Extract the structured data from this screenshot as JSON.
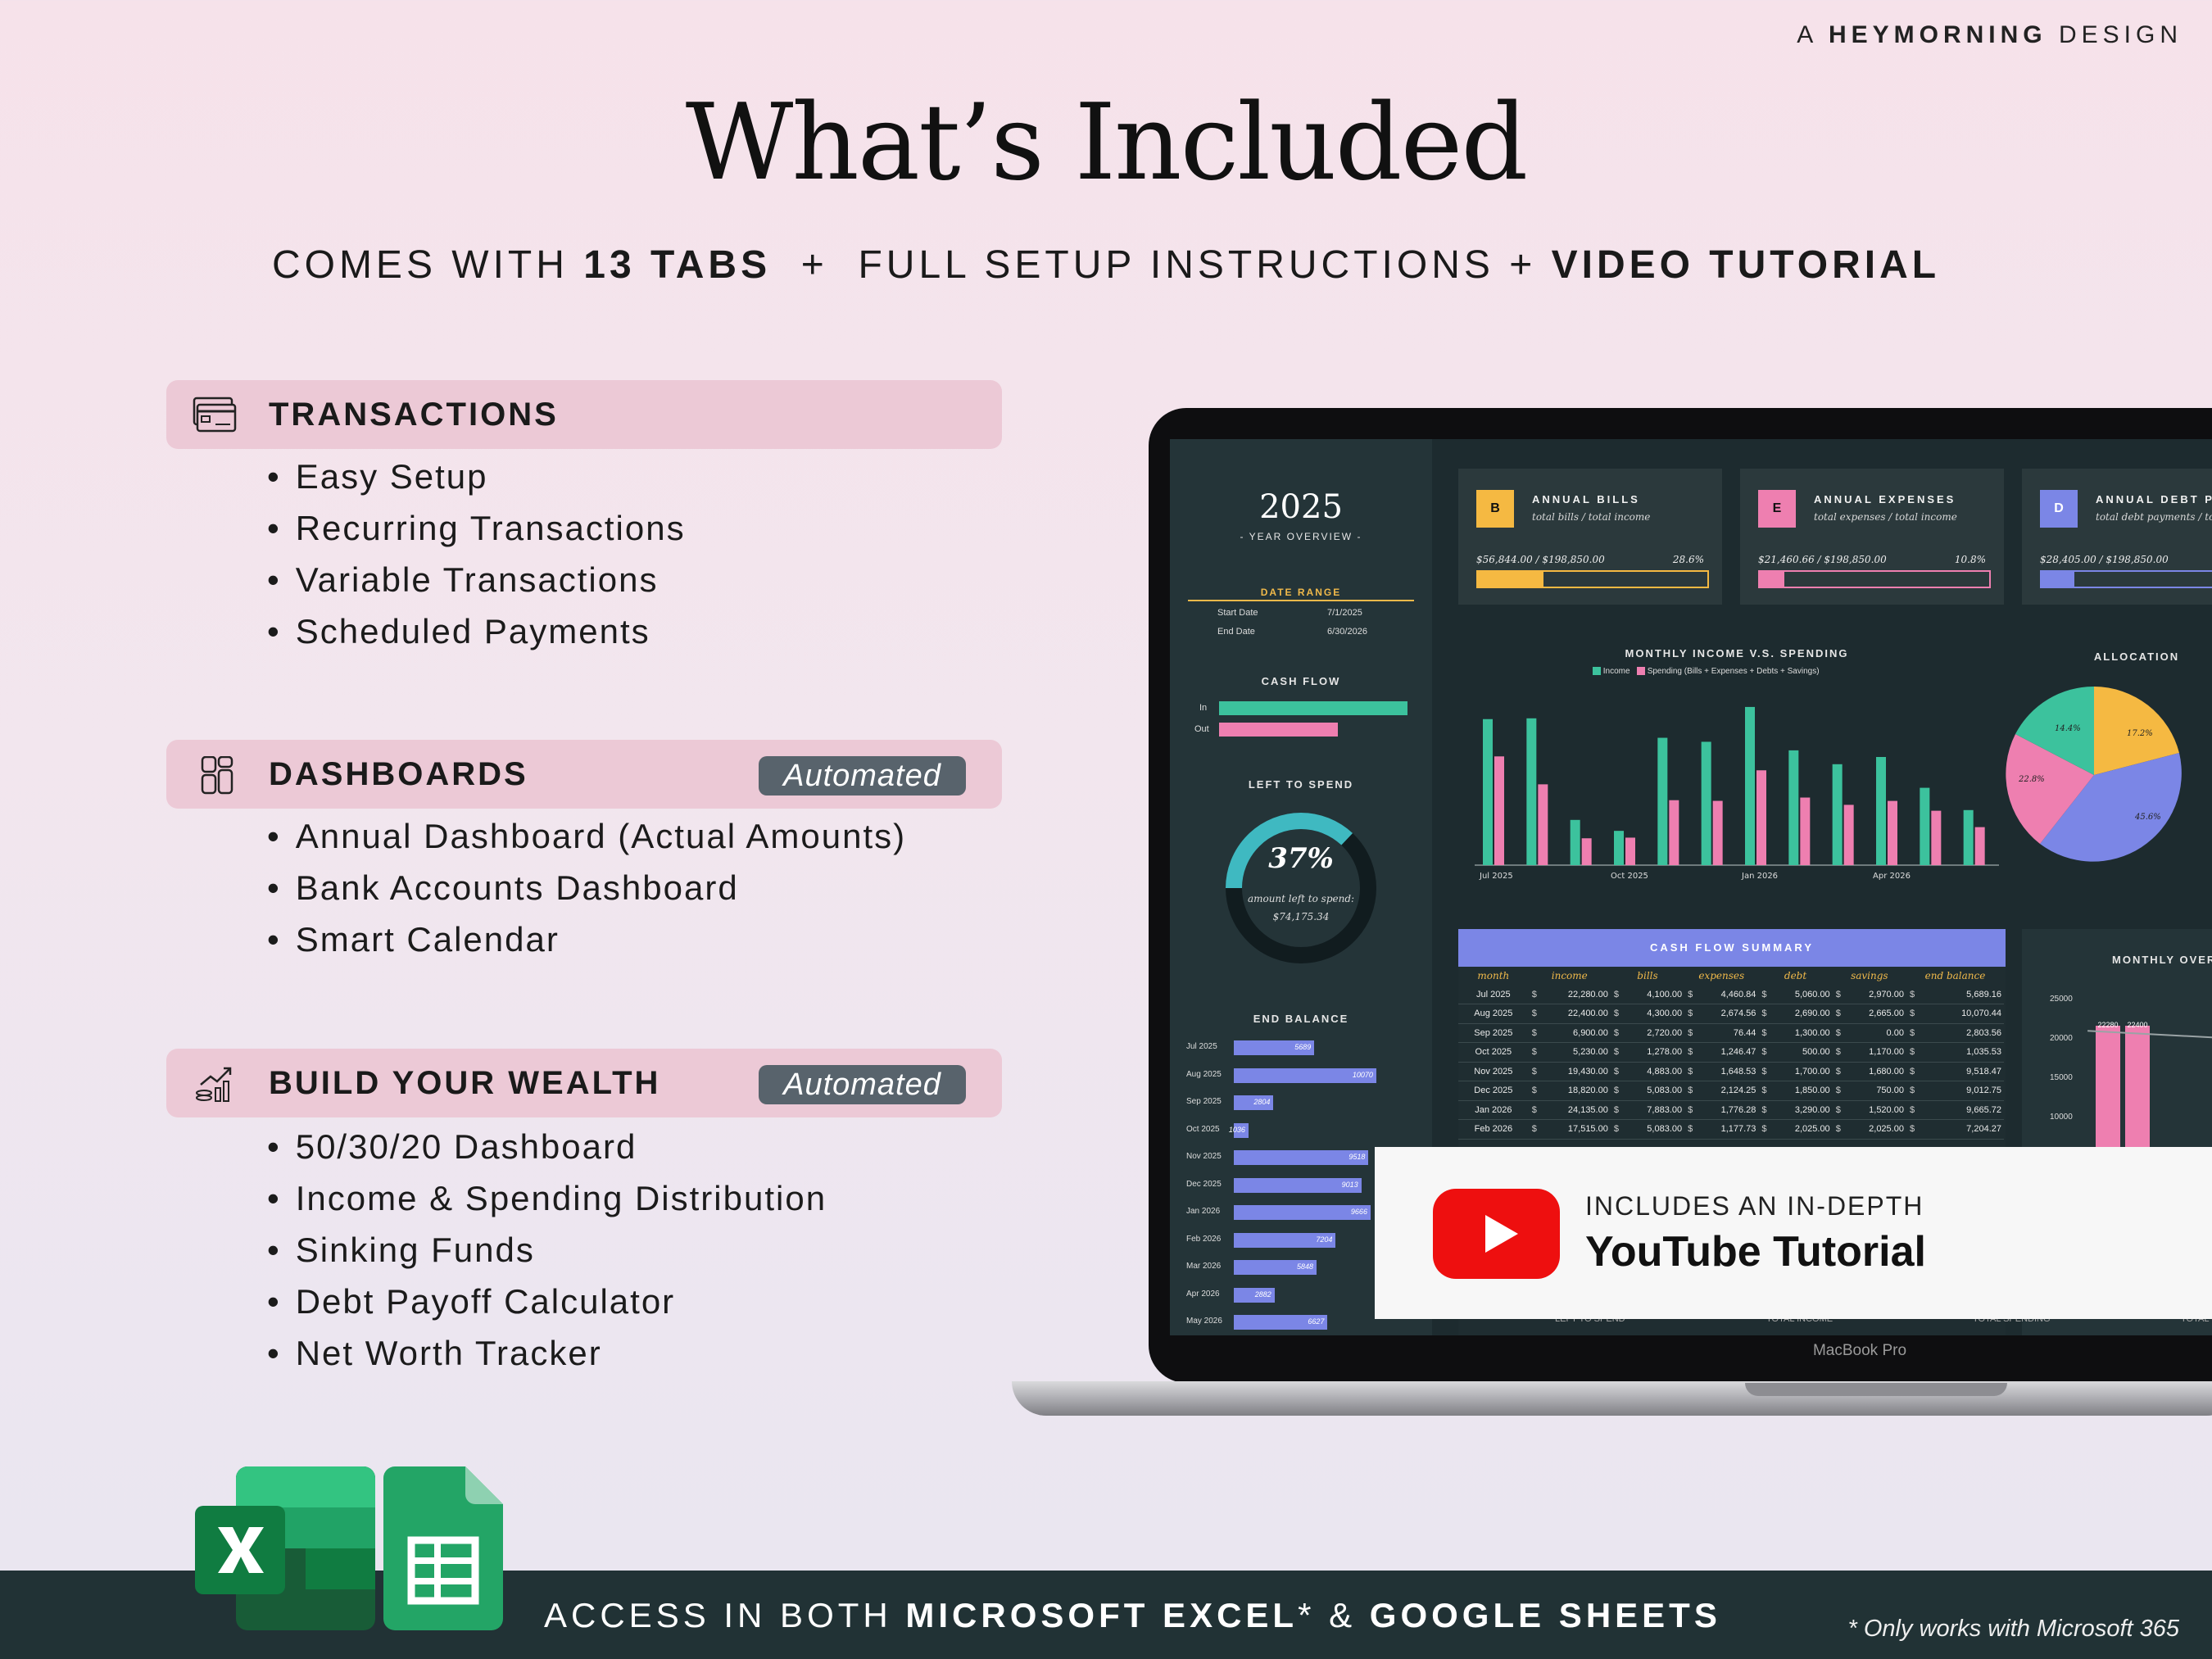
{
  "brand": {
    "prefix": "A ",
    "name": "HEYMORNING",
    "suffix": " DESIGN"
  },
  "title": "What’s Included",
  "subtitle": {
    "p1": "COMES WITH ",
    "b1": "13 TABS",
    "p2": "  +  FULL SETUP INSTRUCTIONS + ",
    "b2": "VIDEO TUTORIAL"
  },
  "sections": [
    {
      "label": "TRANSACTIONS",
      "icon": "credit-card-icon",
      "items": [
        "Easy Setup",
        "Recurring Transactions",
        "Variable Transactions",
        "Scheduled Payments"
      ]
    },
    {
      "label": "DASHBOARDS",
      "icon": "dashboard-grid-icon",
      "badge": "Automated",
      "items": [
        "Annual Dashboard (Actual Amounts)",
        "Bank Accounts Dashboard",
        "Smart Calendar"
      ]
    },
    {
      "label": "BUILD YOUR WEALTH",
      "icon": "growth-chart-icon",
      "badge": "Automated",
      "items": [
        "50/30/20 Dashboard",
        "Income & Spending Distribution",
        "Sinking Funds",
        "Debt Payoff Calculator",
        "Net Worth Tracker"
      ]
    }
  ],
  "laptop": {
    "model": "MacBook Pro"
  },
  "dashboard": {
    "year": "2025",
    "year_label": "- YEAR OVERVIEW -",
    "date_range": {
      "label": "DATE RANGE",
      "start_label": "Start Date",
      "start": "7/1/2025",
      "end_label": "End Date",
      "end": "6/30/2026"
    },
    "cash_flow": {
      "label": "CASH FLOW",
      "in_label": "In",
      "out_label": "Out",
      "in_value": 1.0,
      "out_value": 0.63
    },
    "left_to_spend": {
      "label": "LEFT TO SPEND",
      "percent": "37%",
      "caption": "amount left to spend:",
      "amount": "$74,175.34",
      "fraction": 0.37
    },
    "end_balance": {
      "label": "END BALANCE",
      "rows": [
        {
          "m": "Jul 2025",
          "v": 5689
        },
        {
          "m": "Aug 2025",
          "v": 10070
        },
        {
          "m": "Sep 2025",
          "v": 2804
        },
        {
          "m": "Oct 2025",
          "v": 1036
        },
        {
          "m": "Nov 2025",
          "v": 9518
        },
        {
          "m": "Dec 2025",
          "v": 9013
        },
        {
          "m": "Jan 2026",
          "v": 9666
        },
        {
          "m": "Feb 2026",
          "v": 7204
        },
        {
          "m": "Mar 2026",
          "v": 5848
        },
        {
          "m": "Apr 2026",
          "v": 2882
        },
        {
          "m": "May 2026",
          "v": 6627
        }
      ]
    },
    "kpis": [
      {
        "letter": "B",
        "title": "ANNUAL BILLS",
        "sub": "total bills / total income",
        "amount": "$56,844.00 / $198,850.00",
        "pct": "28.6%",
        "color": "#f5b942",
        "fill": 0.286
      },
      {
        "letter": "E",
        "title": "ANNUAL EXPENSES",
        "sub": "total expenses / total income",
        "amount": "$21,460.66 / $198,850.00",
        "pct": "10.8%",
        "color": "#ee7fb0",
        "fill": 0.108
      },
      {
        "letter": "D",
        "title": "ANNUAL DEBT PA",
        "sub": "total debt payments / tota",
        "amount": "$28,405.00 / $198,850.00",
        "pct": "",
        "color": "#7b86e6",
        "fill": 0.143
      }
    ],
    "monthly_chart": {
      "title": "MONTHLY INCOME V.S. SPENDING",
      "legend": [
        "Income",
        "Spending (Bills + Expenses + Debts + Savings)"
      ],
      "ticks": [
        "Jul 2025",
        "Oct 2025",
        "Jan 2026",
        "Apr 2026"
      ]
    },
    "allocation": {
      "title": "ALLOCATION",
      "labels": [
        "14.4%",
        "17.2%",
        "22.8%",
        "45.6%"
      ]
    },
    "cash_flow_summary": {
      "title": "CASH FLOW SUMMARY",
      "headers": [
        "month",
        "income",
        "bills",
        "expenses",
        "debt",
        "savings",
        "end balance"
      ],
      "rows": [
        [
          "Jul 2025",
          "22,280.00",
          "4,100.00",
          "4,460.84",
          "5,060.00",
          "2,970.00",
          "5,689.16"
        ],
        [
          "Aug 2025",
          "22,400.00",
          "4,300.00",
          "2,674.56",
          "2,690.00",
          "2,665.00",
          "10,070.44"
        ],
        [
          "Sep 2025",
          "6,900.00",
          "2,720.00",
          "76.44",
          "1,300.00",
          "0.00",
          "2,803.56"
        ],
        [
          "Oct 2025",
          "5,230.00",
          "1,278.00",
          "1,246.47",
          "500.00",
          "1,170.00",
          "1,035.53"
        ],
        [
          "Nov 2025",
          "19,430.00",
          "4,883.00",
          "1,648.53",
          "1,700.00",
          "1,680.00",
          "9,518.47"
        ],
        [
          "Dec 2025",
          "18,820.00",
          "5,083.00",
          "2,124.25",
          "1,850.00",
          "750.00",
          "9,012.75"
        ],
        [
          "Jan 2026",
          "24,135.00",
          "7,883.00",
          "1,776.28",
          "3,290.00",
          "1,520.00",
          "9,665.72"
        ],
        [
          "Feb 2026",
          "17,515.00",
          "5,083.00",
          "1,177.73",
          "2,025.00",
          "2,025.00",
          "7,204.27"
        ]
      ]
    },
    "monthly_overview": {
      "title": "MONTHLY OVERVI",
      "yticks": [
        "25000",
        "20000",
        "15000",
        "10000"
      ],
      "labels": [
        "22280",
        "22400"
      ]
    },
    "bottom_labels": [
      "LEFT TO SPEND",
      "TOTAL INCOME",
      "TOTAL SPENDING",
      "TOTAL"
    ]
  },
  "chart_data": {
    "type": "bar",
    "title": "MONTHLY INCOME V.S. SPENDING",
    "categories": [
      "Jul 2025",
      "Aug 2025",
      "Sep 2025",
      "Oct 2025",
      "Nov 2025",
      "Dec 2025",
      "Jan 2026",
      "Feb 2026",
      "Mar 2026",
      "Apr 2026",
      "May 2026",
      "Jun 2026"
    ],
    "series": [
      {
        "name": "Income",
        "values": [
          22280,
          22400,
          6900,
          5230,
          19430,
          18820,
          24135,
          17515,
          15400,
          16500,
          11800,
          8400
        ]
      },
      {
        "name": "Spending (Bills + Expenses + Debts + Savings)",
        "values": [
          16591,
          12330,
          4096,
          4194,
          9911,
          9807,
          14469,
          10311,
          9200,
          9800,
          8300,
          5800
        ]
      }
    ],
    "colors": {
      "Income": "#3cc29d",
      "Spending": "#ee7fb0"
    },
    "ylim": [
      0,
      25000
    ]
  },
  "youtube": {
    "line1": "INCLUDES AN IN-DEPTH",
    "line2": "YouTube Tutorial"
  },
  "footer": {
    "p1": "ACCESS IN BOTH ",
    "b1": "MICROSOFT EXCEL",
    "p2": "* & ",
    "b2": "GOOGLE SHEETS",
    "note": "* Only works with Microsoft 365"
  }
}
